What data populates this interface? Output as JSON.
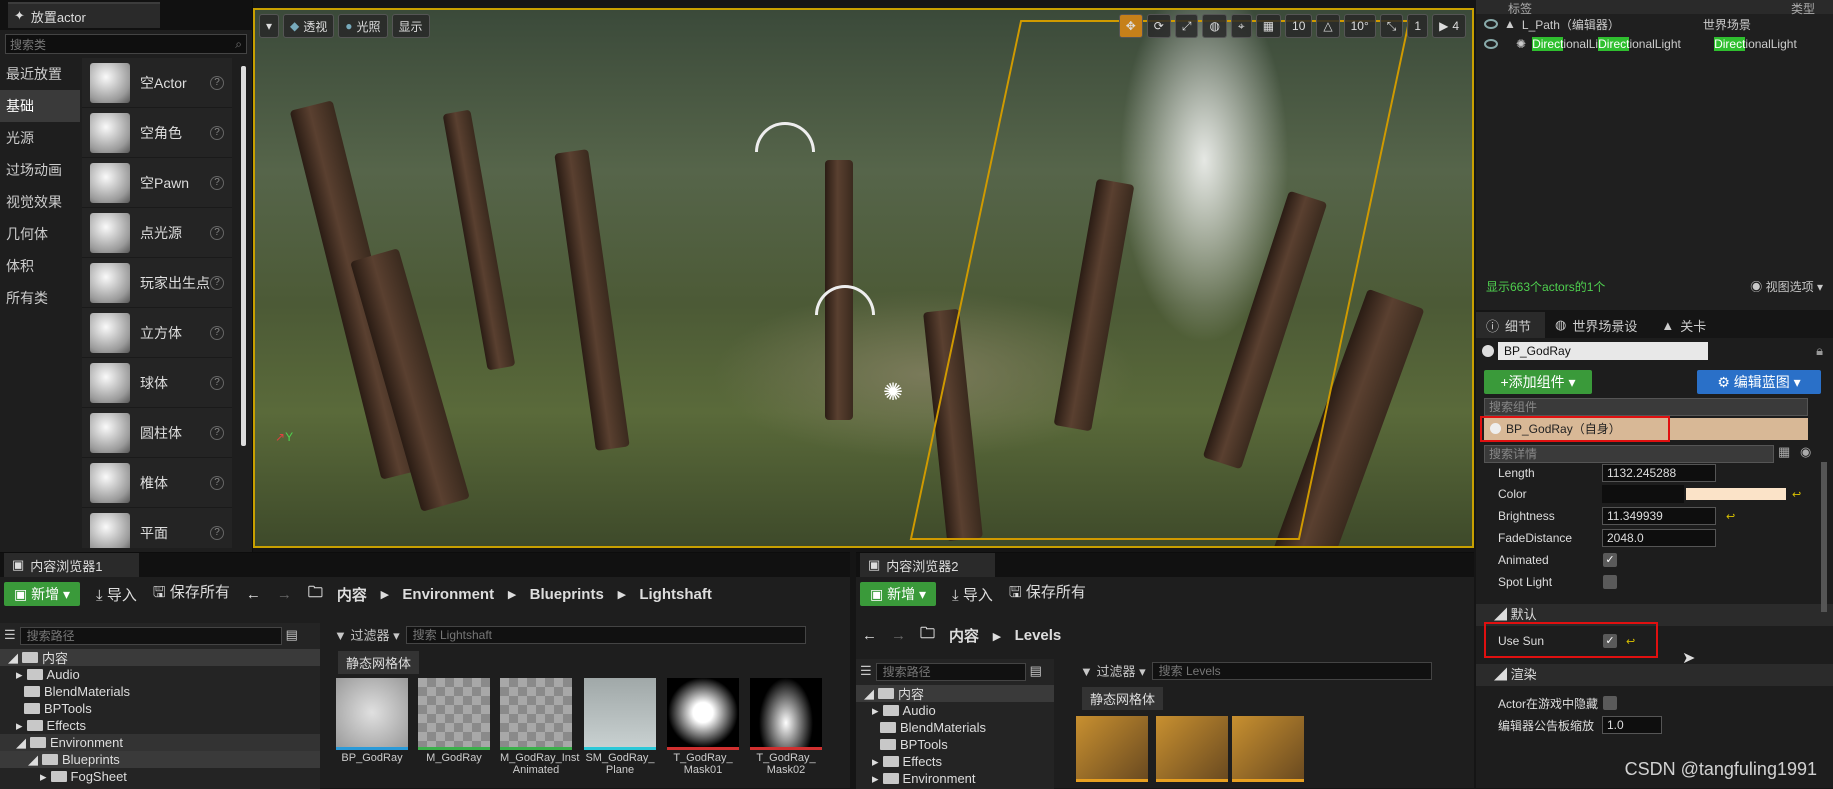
{
  "place_actor": {
    "tab_title": "放置actor",
    "search_placeholder": "搜索类",
    "categories": [
      "最近放置",
      "基础",
      "光源",
      "过场动画",
      "视觉效果",
      "几何体",
      "体积",
      "所有类"
    ],
    "items": [
      "空Actor",
      "空角色",
      "空Pawn",
      "点光源",
      "玩家出生点",
      "立方体",
      "球体",
      "圆柱体",
      "椎体",
      "平面"
    ]
  },
  "viewport": {
    "toolbar": {
      "perspective": "透视",
      "lit": "光照",
      "show": "显示",
      "grid": "10",
      "angle": "10°",
      "speed": "4",
      "cam": "1"
    },
    "axis": {
      "y": "Y"
    }
  },
  "outliner": {
    "col_label": "标签",
    "col_type": "类型",
    "rows": [
      {
        "name": "L_Path（编辑器）",
        "type": "世界场景"
      },
      {
        "name": "DirectionalLightDirectionalLight",
        "type": "DirectionalLight",
        "hl1": "Direct",
        "mid": "ionalLi",
        "hl2": "Direct",
        "rest": "ionalLight",
        "thl": "Direct",
        "trest": "ionalLight"
      }
    ],
    "status": "显示663个actors的1个",
    "view_options": "视图选项"
  },
  "details": {
    "tabs": [
      "细节",
      "世界场景设",
      "关卡"
    ],
    "actor_name": "BP_GodRay",
    "add_component": "+添加组件",
    "edit_blueprint": "编辑蓝图",
    "search_components": "搜索组件",
    "component_self": "BP_GodRay（自身）",
    "search_details": "搜索详情",
    "props": [
      {
        "name": "Length",
        "value": "1132.245288"
      },
      {
        "name": "Color",
        "value": ""
      },
      {
        "name": "Brightness",
        "value": "11.349939"
      },
      {
        "name": "FadeDistance",
        "value": "2048.0"
      }
    ],
    "checks": [
      {
        "name": "Animated",
        "checked": true
      },
      {
        "name": "Spot Light",
        "checked": false
      }
    ],
    "section_default": "默认",
    "use_sun": "Use Sun",
    "section_render": "渲染",
    "hide_in_game": "Actor在游戏中隐藏",
    "billboard_scale": "编辑器公告板缩放",
    "billboard_value": "1.0"
  },
  "cb1": {
    "tab": "内容浏览器1",
    "new": "新增",
    "import": "导入",
    "save_all": "保存所有",
    "path": [
      "内容",
      "Environment",
      "Blueprints",
      "Lightshaft"
    ],
    "search_path": "搜索路径",
    "filter": "过滤器",
    "search_assets": "搜索 Lightshaft",
    "static_mesh": "静态网格体",
    "tree": [
      "内容",
      "Audio",
      "BlendMaterials",
      "BPTools",
      "Effects",
      "Environment",
      "Blueprints",
      "FogSheet"
    ],
    "assets": [
      "BP_GodRay",
      "M_GodRay",
      "M_GodRay_Inst Animated",
      "SM_GodRay_ Plane",
      "T_GodRay_ Mask01",
      "T_GodRay_ Mask02"
    ]
  },
  "cb2": {
    "tab": "内容浏览器2",
    "new": "新增",
    "import": "导入",
    "save_all": "保存所有",
    "path": [
      "内容",
      "Levels"
    ],
    "search_path": "搜索路径",
    "filter": "过滤器",
    "search_assets": "搜索 Levels",
    "static_mesh": "静态网格体",
    "tree": [
      "内容",
      "Audio",
      "BlendMaterials",
      "BPTools",
      "Effects",
      "Environment"
    ]
  },
  "watermark": "CSDN @tangfuling1991",
  "colors": {
    "accent_green": "#3a9a3a",
    "accent_blue": "#2a70c8",
    "highlight_red": "#e01010",
    "viewport_border": "#c8a000"
  }
}
